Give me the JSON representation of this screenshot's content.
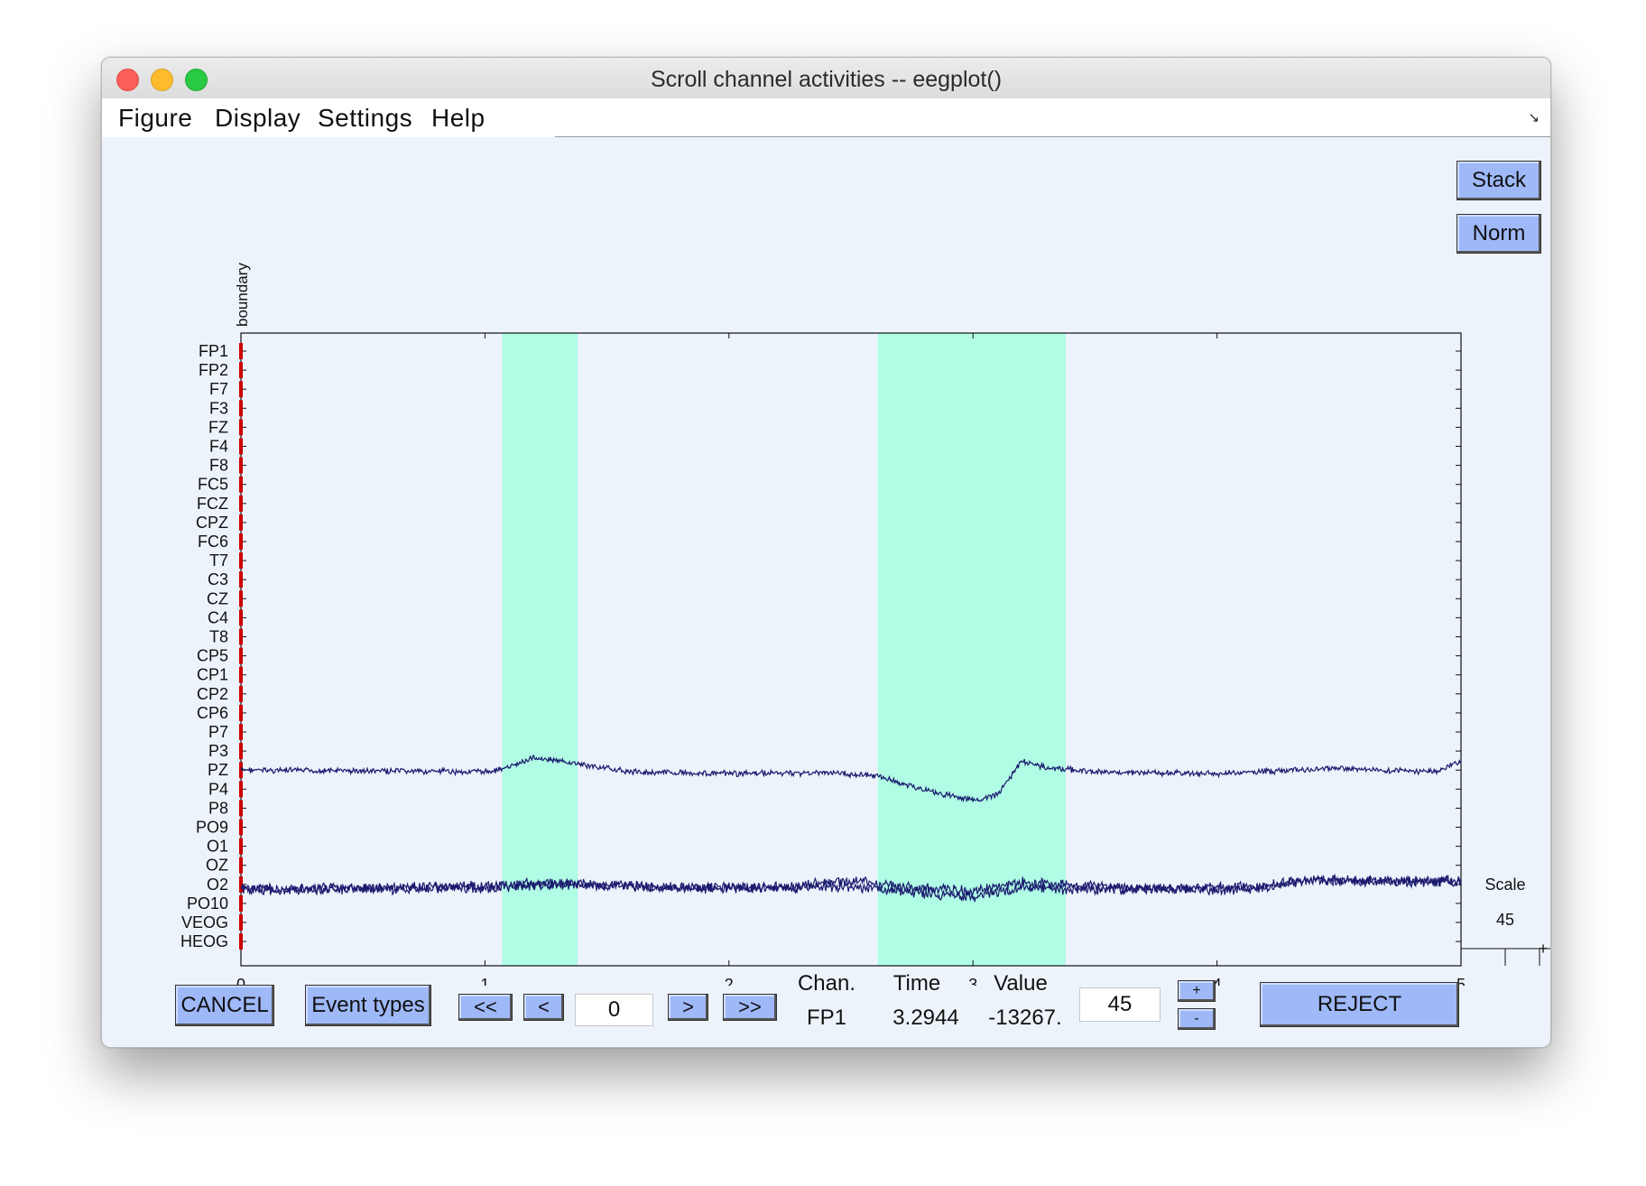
{
  "window": {
    "title": "Scroll channel activities -- eegplot()"
  },
  "menu": [
    "Figure",
    "Display",
    "Settings",
    "Help"
  ],
  "side_buttons": {
    "stack": "Stack",
    "norm": "Norm"
  },
  "event_marker": {
    "label": "boundary",
    "color": "#cc0000"
  },
  "colors": {
    "trace": "#1a1a6e",
    "highlight": "#b0fce4",
    "button": "#9eb8f8",
    "window_bg": "#edf3fb"
  },
  "channels": [
    "FP1",
    "FP2",
    "F7",
    "F3",
    "FZ",
    "F4",
    "F8",
    "FC5",
    "FCZ",
    "CPZ",
    "FC6",
    "T7",
    "C3",
    "CZ",
    "C4",
    "T8",
    "CP5",
    "CP1",
    "CP2",
    "CP6",
    "P7",
    "P3",
    "PZ",
    "P4",
    "P8",
    "PO9",
    "O1",
    "OZ",
    "O2",
    "PO10",
    "VEOG",
    "HEOG"
  ],
  "chart_data": {
    "type": "line",
    "x_ticks": [
      "0",
      "1",
      "2",
      "3",
      "4",
      "5"
    ],
    "xlim": [
      0,
      5
    ],
    "highlighted_intervals": [
      [
        1.07,
        1.38
      ],
      [
        2.61,
        3.38
      ]
    ],
    "series": [
      {
        "center_channel": "PZ",
        "baseline_offset": [
          [
            0,
            0
          ],
          [
            1.0,
            -2
          ],
          [
            1.1,
            3
          ],
          [
            1.2,
            14
          ],
          [
            1.4,
            6
          ],
          [
            1.6,
            -2
          ],
          [
            2.0,
            -4
          ],
          [
            2.4,
            -3
          ],
          [
            2.6,
            -6
          ],
          [
            2.8,
            -22
          ],
          [
            3.0,
            -34
          ],
          [
            3.1,
            -28
          ],
          [
            3.2,
            10
          ],
          [
            3.3,
            3
          ],
          [
            3.5,
            -2
          ],
          [
            4.0,
            -4
          ],
          [
            4.5,
            2
          ],
          [
            4.9,
            -2
          ],
          [
            5.0,
            10
          ]
        ]
      },
      {
        "center_channel": "O2",
        "baseline_offset": [
          [
            0,
            -6
          ],
          [
            1.0,
            -4
          ],
          [
            1.3,
            0
          ],
          [
            1.8,
            -4
          ],
          [
            2.2,
            -4
          ],
          [
            2.5,
            -3
          ],
          [
            2.8,
            -10
          ],
          [
            3.0,
            -14
          ],
          [
            3.1,
            -8
          ],
          [
            3.2,
            -4
          ],
          [
            3.5,
            -6
          ],
          [
            4.0,
            -4
          ],
          [
            4.2,
            -2
          ],
          [
            4.3,
            4
          ],
          [
            4.5,
            4
          ],
          [
            4.8,
            2
          ],
          [
            5.0,
            4
          ]
        ]
      },
      {
        "center_channel": "O2",
        "baseline_offset": [
          [
            0,
            -6
          ],
          [
            1.0,
            -2
          ],
          [
            1.3,
            2
          ],
          [
            1.8,
            -4
          ],
          [
            2.2,
            -3
          ],
          [
            2.5,
            4
          ],
          [
            2.7,
            -2
          ],
          [
            3.0,
            -8
          ],
          [
            3.2,
            2
          ],
          [
            3.5,
            -2
          ],
          [
            4.0,
            -6
          ],
          [
            4.2,
            -4
          ],
          [
            4.4,
            6
          ],
          [
            4.6,
            4
          ],
          [
            5.0,
            4
          ]
        ]
      }
    ]
  },
  "scale": {
    "label": "Scale",
    "value": "45"
  },
  "controls": {
    "cancel": "CANCEL",
    "event_types": "Event types",
    "first": "<<",
    "prev": "<",
    "position": "0",
    "next": ">",
    "last": ">>",
    "scale_value": "45",
    "plus": "+",
    "minus": "-",
    "reject": "REJECT"
  },
  "readout": {
    "chan_label": "Chan.",
    "time_label": "Time",
    "value_label": "Value",
    "chan": "FP1",
    "time": "3.2944",
    "value": "-13267."
  }
}
